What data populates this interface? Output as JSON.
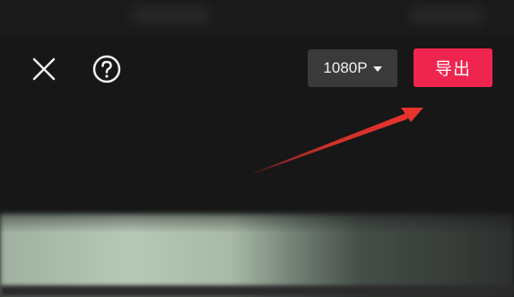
{
  "toolbar": {
    "close_icon": "close-icon",
    "help_icon": "help-icon",
    "resolution_label": "1080P",
    "export_label": "导出"
  },
  "colors": {
    "background": "#171717",
    "export_button": "#f0254f",
    "resolution_button": "#3a3a3a",
    "annotation_arrow": "#e8342c"
  }
}
